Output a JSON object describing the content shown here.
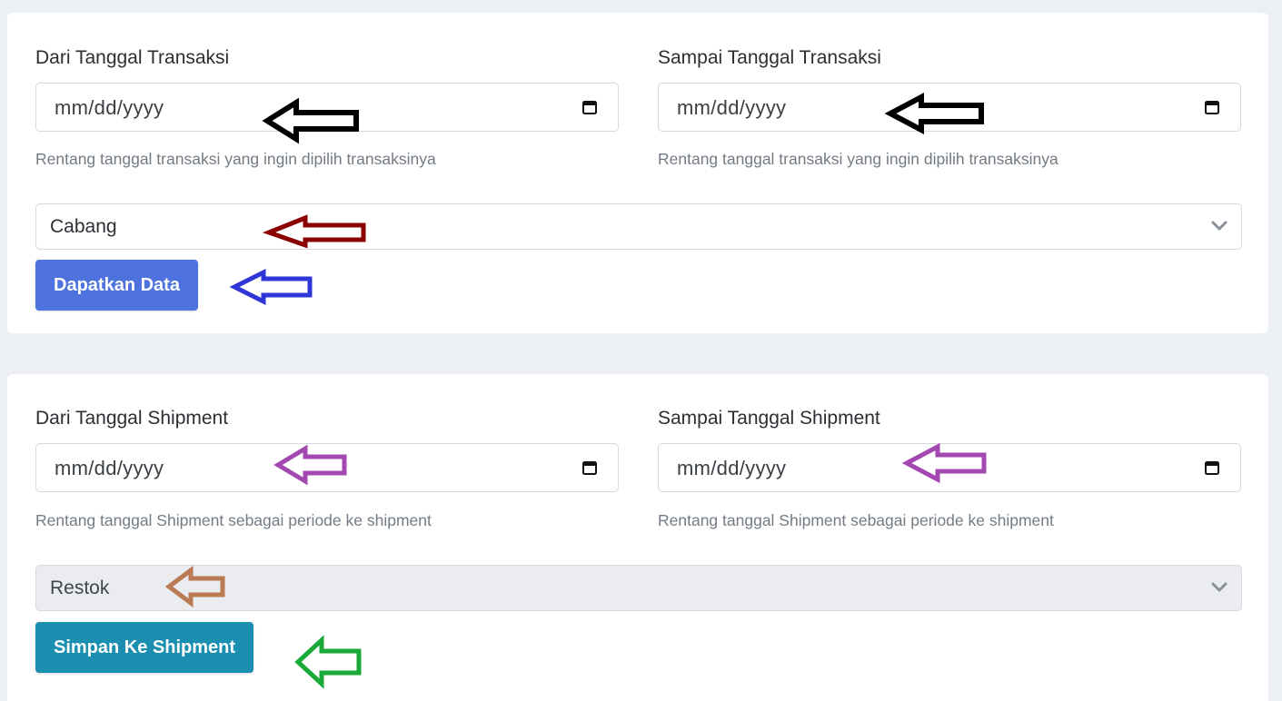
{
  "transaction_section": {
    "from_label": "Dari Tanggal Transaksi",
    "to_label": "Sampai Tanggal Transaksi",
    "from_value": "mm/dd/yyyy",
    "to_value": "mm/dd/yyyy",
    "help_text": "Rentang tanggal transaksi yang ingin dipilih transaksinya",
    "branch_select": "Cabang",
    "get_data_button": "Dapatkan Data"
  },
  "shipment_section": {
    "from_label": "Dari Tanggal Shipment",
    "to_label": "Sampai Tanggal Shipment",
    "from_value": "mm/dd/yyyy",
    "to_value": "mm/dd/yyyy",
    "help_text": "Rentang tanggal Shipment sebagai periode ke shipment",
    "type_select": "Restok",
    "save_button": "Simpan Ke Shipment"
  },
  "icons": {
    "calendar": "calendar-icon",
    "dropdown": "chevron-down-icon",
    "annotation": "arrow-left-icon"
  },
  "colors": {
    "primary_button": "#4e73df",
    "info_button": "#1a8fb0",
    "disabled_select": "#eaecef",
    "arrow_black": "#000000",
    "arrow_darkred": "#8b0000",
    "arrow_blue": "#2f35d6",
    "arrow_purple": "#a348b0",
    "arrow_brown": "#b97a54",
    "arrow_green": "#1aaa3a"
  }
}
